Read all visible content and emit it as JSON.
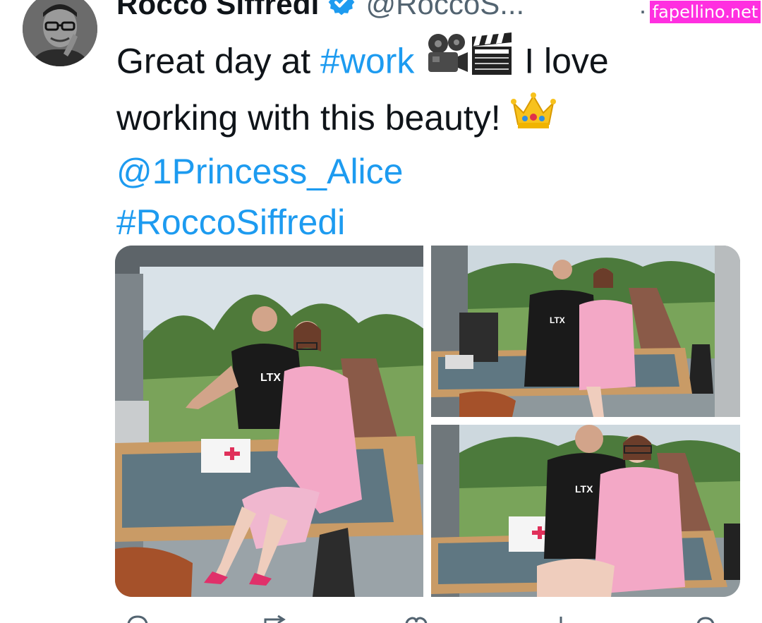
{
  "header": {
    "display_name": "Rocco Siffredi",
    "handle": "@RoccoS...",
    "separator": "·",
    "verified": true
  },
  "watermark": {
    "text": "fapellino.net",
    "color": "#ff2fe0"
  },
  "tweet": {
    "line1": {
      "text_before": "Great day at ",
      "hashtag": "#work",
      "text_after": " I love"
    },
    "line2": {
      "text": "working with this beauty! "
    },
    "mention": "@1Princess_Alice",
    "hashtag2": "#RoccoSiffredi"
  },
  "media": {
    "photo_count": 3,
    "shirt_text": "LTX"
  },
  "icons": {
    "verified": "verified-badge-icon",
    "projector": "film-projector-emoji",
    "clapper": "clapper-board-emoji",
    "crown": "crown-emoji"
  },
  "colors": {
    "link": "#1d9bf0",
    "text": "#0f1419",
    "secondary": "#536471",
    "verified": "#1d9bf0"
  }
}
